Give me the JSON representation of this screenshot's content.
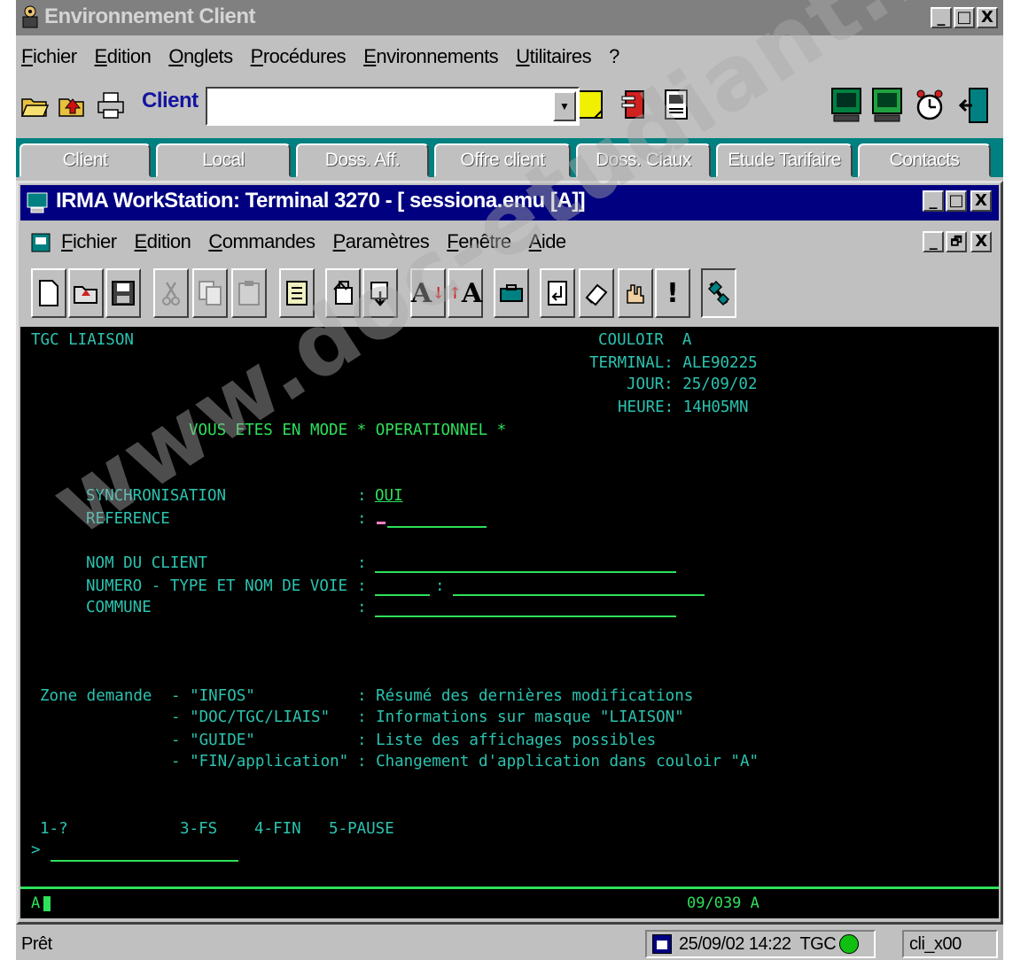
{
  "outer_window": {
    "title": "Environnement Client",
    "controls": {
      "minimize": "_",
      "maximize": "□",
      "close": "X"
    }
  },
  "outer_menu": [
    "Fichier",
    "Edition",
    "Onglets",
    "Procédures",
    "Environnements",
    "Utilitaires",
    "?"
  ],
  "client_bar": {
    "label": "Client",
    "value": ""
  },
  "tabs": [
    "Client",
    "Local",
    "Doss. Aff.",
    "Offre client",
    "Doss. Ciaux",
    "Etude Tarifaire",
    "Contacts"
  ],
  "inner_window": {
    "title": "IRMA WorkStation: Terminal 3270   - [ sessiona.emu [A]]",
    "controls": {
      "minimize": "_",
      "maximize": "□",
      "close": "X"
    },
    "mdi_controls": {
      "minimize": "_",
      "restore": "🗗",
      "close": "X"
    }
  },
  "inner_menu": [
    "Fichier",
    "Edition",
    "Commandes",
    "Paramètres",
    "Fenêtre",
    "Aide"
  ],
  "terminal": {
    "screen_name": "TGC LIAISON",
    "couloir": "COULOIR  A",
    "terminal_id": "TERMINAL: ALE90225",
    "jour": "JOUR: 25/09/02",
    "heure": "HEURE: 14H05MN",
    "mode_line": "VOUS ETES EN MODE * OPERATIONNEL *",
    "fields": {
      "synchronisation_label": "SYNCHRONISATION",
      "synchronisation_value": "OUI",
      "reference_label": "REFERENCE",
      "nom_client_label": "NOM DU CLIENT",
      "numero_label": "NUMERO - TYPE ET NOM DE VOIE",
      "commune_label": "COMMUNE"
    },
    "help": {
      "zone_label": "Zone demande",
      "rows": [
        {
          "code": "- \"INFOS\"",
          "desc": ": Résumé des dernières modifications"
        },
        {
          "code": "- \"DOC/TGC/LIAIS\"",
          "desc": ": Informations sur masque \"LIAISON\""
        },
        {
          "code": "- \"GUIDE\"",
          "desc": ": Liste des affichages possibles"
        },
        {
          "code": "- \"FIN/application\"",
          "desc": ": Changement d'application dans couloir \"A\""
        }
      ]
    },
    "function_keys": [
      "1-?",
      "3-FS",
      "4-FIN",
      "5-PAUSE"
    ],
    "prompt": ">",
    "status_left": "A",
    "status_right": "09/039 A"
  },
  "statusbar": {
    "left": "Prêt",
    "datetime": "25/09/02 14:22",
    "app": "TGC",
    "user": "cli_x00"
  },
  "watermark": "www.doc-etudiant.fr",
  "colors": {
    "title_active": "#000080",
    "tabs_bg": "#008080",
    "terminal_cyan": "#2bc3b0",
    "terminal_green": "#2ee05a"
  }
}
